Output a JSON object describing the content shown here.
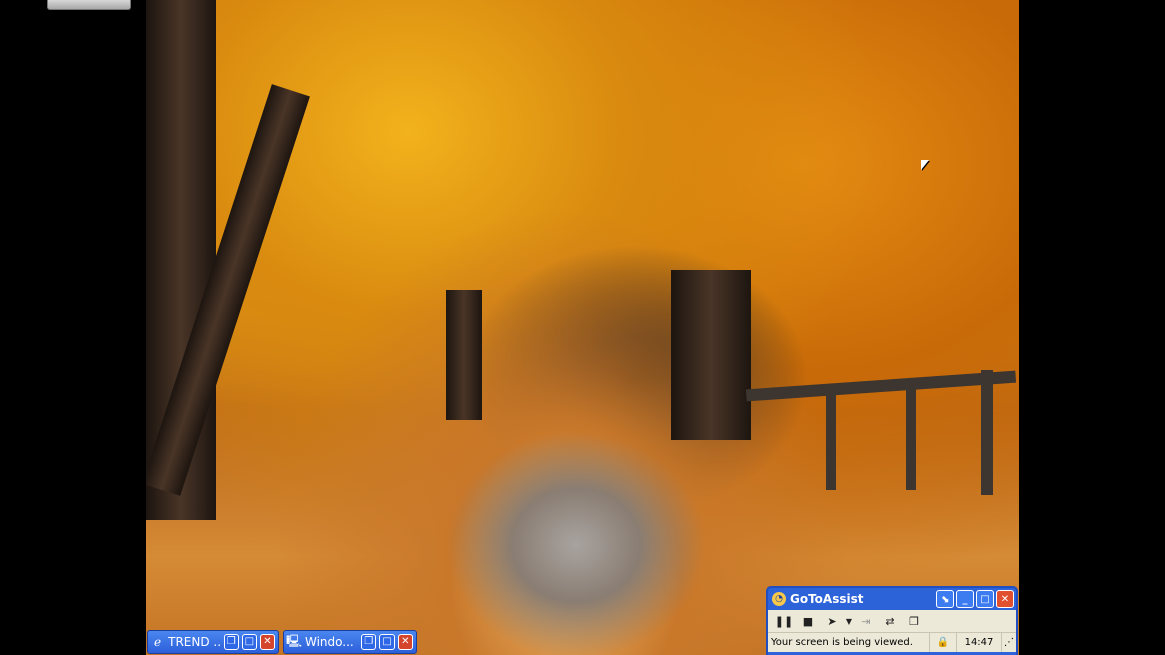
{
  "taskbar": {
    "items": [
      {
        "label": "TREND ...",
        "icon": "ie-icon"
      },
      {
        "label": "Windo...",
        "icon": "computer-icon"
      }
    ]
  },
  "gotoassist": {
    "title": "GoToAssist",
    "status_message": "Your screen is being viewed.",
    "clock": "14:47",
    "toolbar": [
      "pause",
      "stop",
      "pointer",
      "dropdown",
      "transfer",
      "swap",
      "window"
    ]
  },
  "colors": {
    "xp_blue": "#2d63d8",
    "xp_close": "#d4452c",
    "panel_bg": "#ece9d8"
  }
}
